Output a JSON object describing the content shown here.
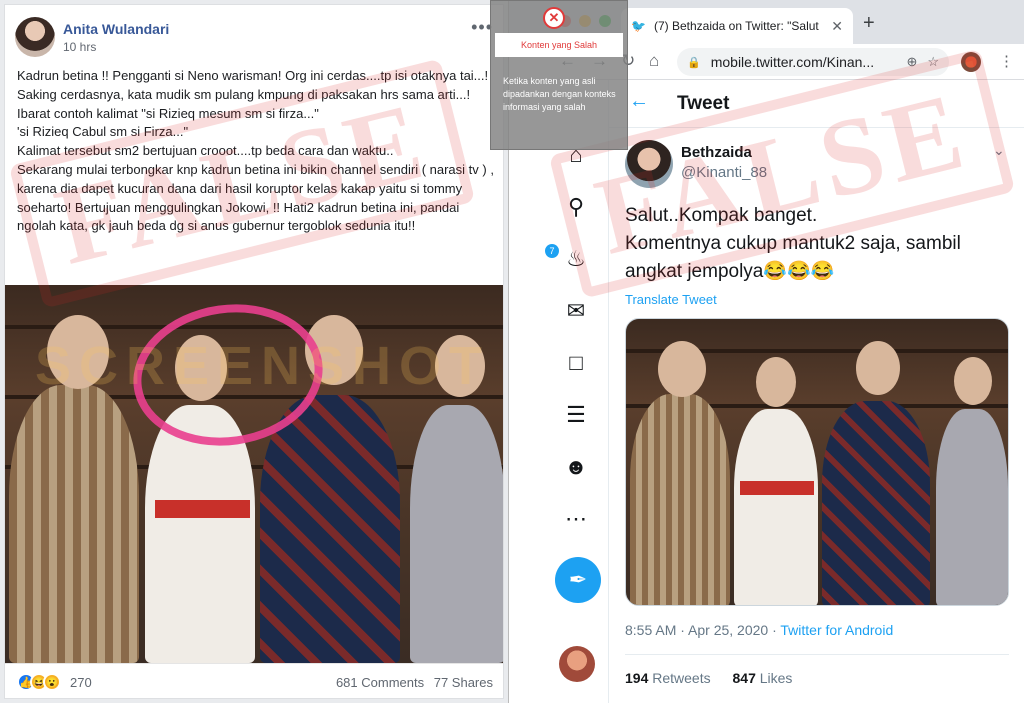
{
  "facebook_post": {
    "author": "Anita Wulandari",
    "time": "10 hrs",
    "more_icon": "•••",
    "text": "Kadrun betina !! Pengganti si Neno warisman! Org ini cerdas....tp isi otaknya tai...! Saking cerdasnya, kata mudik sm pulang kmpung di paksakan hrs sama arti...! Ibarat contoh kalimat \"si Rizieq mesum sm si firza...\"\n'si Rizieq Cabul sm si Firza...\"\nKalimat tersebut sm2 bertujuan crooot....tp beda cara dan waktu..\nSekarang mulai terbongkar knp kadrun betina ini bikin channel sendiri ( narasi tv ) , karena dia dapet kucuran dana dari hasil koruptor kelas kakap yaitu si tommy soeharto! Bertujuan menggulingkan Jokowi, !! Hati2 kadrun betina ini, pandai ngolah kata, gk jauh beda dg si anus gubernur tergoblok sedunia itu!!",
    "reaction_count": "270",
    "comments": "681 Comments",
    "shares": "77 Shares",
    "reaction_icons": [
      "like-icon",
      "haha-icon",
      "wow-icon"
    ],
    "highlight_color": "#e93f8e"
  },
  "overlay": {
    "stamp_text": "FALSE",
    "watermark_text": "SCREENSHOT",
    "label": "Konten yang Salah",
    "description": "Ketika konten yang asli dipadankan dengan konteks informasi yang salah",
    "accent_color": "#e03a3a"
  },
  "browser": {
    "tab_title": "(7) Bethzaida on Twitter: \"Salut",
    "url": "mobile.twitter.com/Kinan...",
    "new_tab_icon": "+",
    "traffic_colors": [
      "#ff5f57",
      "#febc2e",
      "#28c840"
    ]
  },
  "tweet": {
    "page_title": "Tweet",
    "name": "Bethzaida",
    "handle": "@Kinanti_88",
    "text": "Salut..Kompak banget.\nKomentnya cukup mantuk2 saja, sambil angkat jempolya😂😂😂",
    "translate": "Translate Tweet",
    "time": "8:55 AM · Apr 25, 2020 · ",
    "app": "Twitter for Android",
    "retweets": "194",
    "retweets_label": " Retweets",
    "likes": "847",
    "likes_label": " Likes",
    "notification_badge": "7",
    "brand_color": "#1da1f2"
  }
}
